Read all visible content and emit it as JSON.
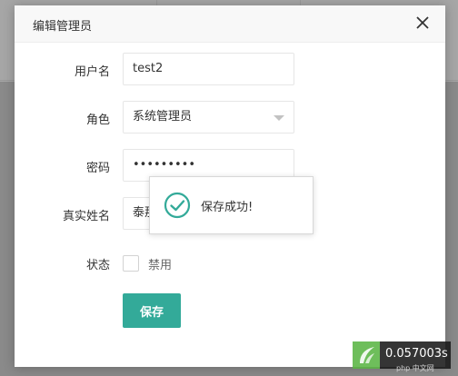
{
  "dialog": {
    "title": "编辑管理员"
  },
  "form": {
    "username": {
      "label": "用户名",
      "value": "test2"
    },
    "role": {
      "label": "角色",
      "value": "系统管理员"
    },
    "password": {
      "label": "密码",
      "value": "•••••••••"
    },
    "real_name": {
      "label": "真实姓名",
      "value": "泰那"
    },
    "status": {
      "label": "状态",
      "checkbox_label": "禁用",
      "checked": false
    },
    "save_label": "保存"
  },
  "toast": {
    "message": "保存成功!",
    "icon": "check-circle-icon",
    "color": "#33aa99"
  },
  "overlay": {
    "timer": "0.057003s",
    "watermark": "php 中文网"
  },
  "colors": {
    "accent": "#33aa99",
    "badge_logo": "#5bb645"
  }
}
